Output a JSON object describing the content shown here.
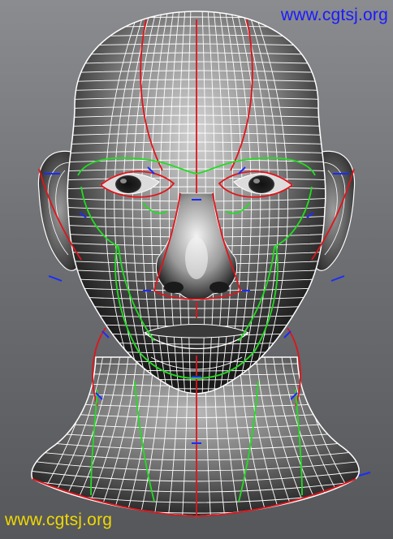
{
  "viewport": {
    "subject": "head-wireframe-model",
    "colors": {
      "background_top": "#8a8c90",
      "background_bottom": "#55575b",
      "skin_light": "#e8e8e8",
      "skin_dark": "#1e1e1e",
      "wire": "#ffffff",
      "edge_loop_red": "#e0141a",
      "edge_loop_green": "#22dd22",
      "marker_blue": "#1a2cff"
    }
  },
  "watermarks": {
    "top": {
      "text": "www.cgtsj.org",
      "color": "#1a1aff"
    },
    "bottom": {
      "text": "www.cgtsj.org",
      "color": "#f0d800"
    }
  }
}
